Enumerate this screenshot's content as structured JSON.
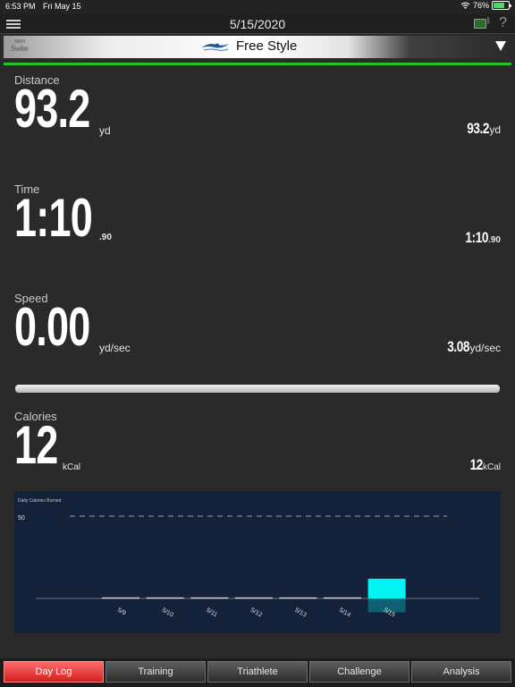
{
  "status_bar": {
    "time": "6:53 PM",
    "date": "Fri May 15",
    "battery": "76%",
    "battery_level": 0.76
  },
  "nav": {
    "title": "5/15/2020",
    "help": "?"
  },
  "style_bar": {
    "logo_top": "MIO",
    "logo_bottom": "Swim",
    "label": "Free Style"
  },
  "metrics": {
    "distance": {
      "label": "Distance",
      "value": "93.2",
      "unit": "yd",
      "right_value": "93.2",
      "right_unit": "yd"
    },
    "time": {
      "label": "Time",
      "value": "1:10",
      "unit": ".90",
      "right_value": "1:10",
      "right_unit": ".90"
    },
    "speed": {
      "label": "Speed",
      "value": "0.00",
      "unit": "yd/sec",
      "right_value": "3.08",
      "right_unit": "yd/sec"
    },
    "calories": {
      "label": "Calories",
      "value": "12",
      "unit": "kCal",
      "right_value": "12",
      "right_unit": "kCal"
    }
  },
  "progress": {
    "fraction": 1.0
  },
  "chart_data": {
    "type": "bar",
    "title": "Daily Calories Burned",
    "categories": [
      "5/9",
      "5/10",
      "5/11",
      "5/12",
      "5/13",
      "5/14",
      "5/15"
    ],
    "values": [
      0,
      0,
      0,
      0,
      0,
      0,
      12
    ],
    "goal_line": 50,
    "goal_label": "50",
    "ylim": [
      0,
      50
    ],
    "highlight_index": 6,
    "colors": {
      "bar": "#00f4f4",
      "bar_reflection": "#0a8a9a",
      "baseline": "#8a8f9a",
      "goal_line": "#9aa0a8",
      "background": "#14213a"
    }
  },
  "tabs": [
    {
      "label": "Day Log",
      "active": true
    },
    {
      "label": "Training",
      "active": false
    },
    {
      "label": "Triathlete",
      "active": false
    },
    {
      "label": "Challenge",
      "active": false
    },
    {
      "label": "Analysis",
      "active": false
    }
  ]
}
